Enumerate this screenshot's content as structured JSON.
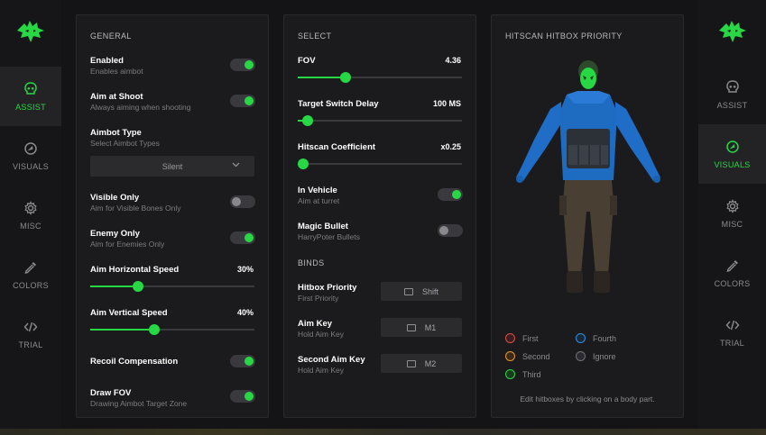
{
  "accent_color": "#27d844",
  "nav_left": [
    {
      "label": "ASSIST",
      "icon": "skull-icon",
      "active": true
    },
    {
      "label": "VISUALS",
      "icon": "eye-icon",
      "active": false
    },
    {
      "label": "MISC",
      "icon": "gear-icon",
      "active": false
    },
    {
      "label": "COLORS",
      "icon": "eyedropper-icon",
      "active": false
    },
    {
      "label": "TRIAL",
      "icon": "code-icon",
      "active": false
    }
  ],
  "nav_right": [
    {
      "label": "ASSIST",
      "icon": "skull-icon",
      "active": false
    },
    {
      "label": "VISUALS",
      "icon": "eye-icon",
      "active": true
    },
    {
      "label": "MISC",
      "icon": "gear-icon",
      "active": false
    },
    {
      "label": "COLORS",
      "icon": "eyedropper-icon",
      "active": false
    },
    {
      "label": "TRIAL",
      "icon": "code-icon",
      "active": false
    }
  ],
  "general": {
    "title": "GENERAL",
    "enabled": {
      "label": "Enabled",
      "sub": "Enables aimbot",
      "on": true
    },
    "aim_at_shoot": {
      "label": "Aim at Shoot",
      "sub": "Always aiming when shooting",
      "on": true
    },
    "aimbot_type": {
      "label": "Aimbot Type",
      "sub": "Select Aimbot Types",
      "value": "Silent"
    },
    "visible_only": {
      "label": "Visible Only",
      "sub": "Aim for Visible Bones Only",
      "on": false
    },
    "enemy_only": {
      "label": "Enemy Only",
      "sub": "Aim for Enemies Only",
      "on": true
    },
    "horizontal_speed": {
      "label": "Aim Horizontal Speed",
      "value": "30%",
      "level": 0.29
    },
    "vertical_speed": {
      "label": "Aim Vertical Speed",
      "value": "40%",
      "level": 0.39
    },
    "recoil": {
      "label": "Recoil Compensation",
      "on": true
    },
    "draw_fov": {
      "label": "Draw FOV",
      "sub": "Drawing Aimbot Target Zone",
      "on": true
    }
  },
  "select": {
    "title": "SELECT",
    "fov": {
      "label": "FOV",
      "value": "4.36",
      "level": 0.29
    },
    "target_switch": {
      "label": "Target Switch Delay",
      "value": "100 MS",
      "level": 0.06
    },
    "hitscan": {
      "label": "Hitscan Coefficient",
      "value": "x0.25",
      "level": 0.0
    },
    "in_vehicle": {
      "label": "In Vehicle",
      "sub": "Aim at turret",
      "on": true
    },
    "magic_bullet": {
      "label": "Magic Bullet",
      "sub": "HarryPoter Bullets",
      "on": false
    },
    "binds_title": "BINDS",
    "hitbox_priority": {
      "label": "Hitbox Priority",
      "sub": "First Priority",
      "key": "Shift"
    },
    "aim_key": {
      "label": "Aim Key",
      "sub": "Hold Aim Key",
      "key": "M1"
    },
    "second_aim_key": {
      "label": "Second Aim Key",
      "sub": "Hold Aim Key",
      "key": "M2"
    }
  },
  "hitbox": {
    "title": "HITSCAN HITBOX PRIORITY",
    "legend": [
      {
        "label": "First",
        "color": "#e04a4a"
      },
      {
        "label": "Second",
        "color": "#e8962e"
      },
      {
        "label": "Third",
        "color": "#27d844"
      },
      {
        "label": "Fourth",
        "color": "#2e8fe8"
      },
      {
        "label": "Ignore",
        "color": "#707078"
      }
    ],
    "hint": "Edit hitboxes by clicking on a body part."
  }
}
